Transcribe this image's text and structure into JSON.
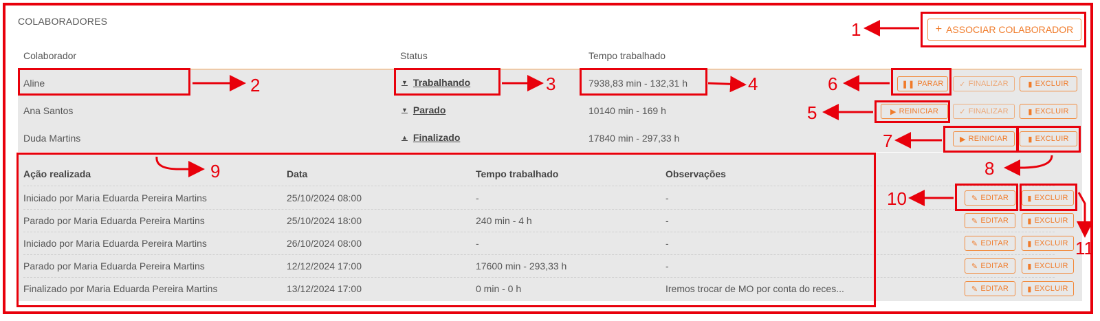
{
  "section_title": "COLABORADORES",
  "associate_button": {
    "icon": "plus-icon",
    "label": "ASSOCIAR COLABORADOR"
  },
  "columns": {
    "colaborador": "Colaborador",
    "status": "Status",
    "tempo": "Tempo trabalhado"
  },
  "rows": [
    {
      "name": "Aline",
      "status": "Trabalhando",
      "caret": "▼",
      "time": "7938,83 min - 132,31 h",
      "actions": [
        "PARAR",
        "FINALIZAR",
        "EXCLUIR"
      ]
    },
    {
      "name": "Ana Santos",
      "status": "Parado",
      "caret": "▼",
      "time": "10140 min - 169 h",
      "actions": [
        "REINICIAR",
        "FINALIZAR",
        "EXCLUIR"
      ]
    },
    {
      "name": "Duda Martins",
      "status": "Finalizado",
      "caret": "▲",
      "time": "17840 min - 297,33 h",
      "actions": [
        "REINICIAR",
        "EXCLUIR"
      ]
    }
  ],
  "history": {
    "headers": [
      "Ação realizada",
      "Data",
      "Tempo trabalhado",
      "Observações"
    ],
    "rows": [
      {
        "action": "Iniciado por Maria Eduarda Pereira Martins",
        "date": "25/10/2024 08:00",
        "time": "-",
        "obs": "-"
      },
      {
        "action": "Parado por Maria Eduarda Pereira Martins",
        "date": "25/10/2024 18:00",
        "time": "240 min - 4 h",
        "obs": "-"
      },
      {
        "action": "Iniciado por Maria Eduarda Pereira Martins",
        "date": "26/10/2024 08:00",
        "time": "-",
        "obs": "-"
      },
      {
        "action": "Parado por Maria Eduarda Pereira Martins",
        "date": "12/12/2024 17:00",
        "time": "17600 min - 293,33 h",
        "obs": "-"
      },
      {
        "action": "Finalizado por Maria Eduarda Pereira Martins",
        "date": "13/12/2024 17:00",
        "time": "0 min - 0 h",
        "obs": "Iremos trocar de MO por conta do reces..."
      }
    ],
    "edit_label": "EDITAR",
    "delete_label": "EXCLUIR"
  },
  "annotations": [
    "1",
    "2",
    "3",
    "4",
    "5",
    "6",
    "7",
    "8",
    "9",
    "10",
    "11"
  ],
  "colors": {
    "accent": "#f07b2a",
    "annotation": "#e8000b",
    "row_bg": "#e8e8e8"
  }
}
